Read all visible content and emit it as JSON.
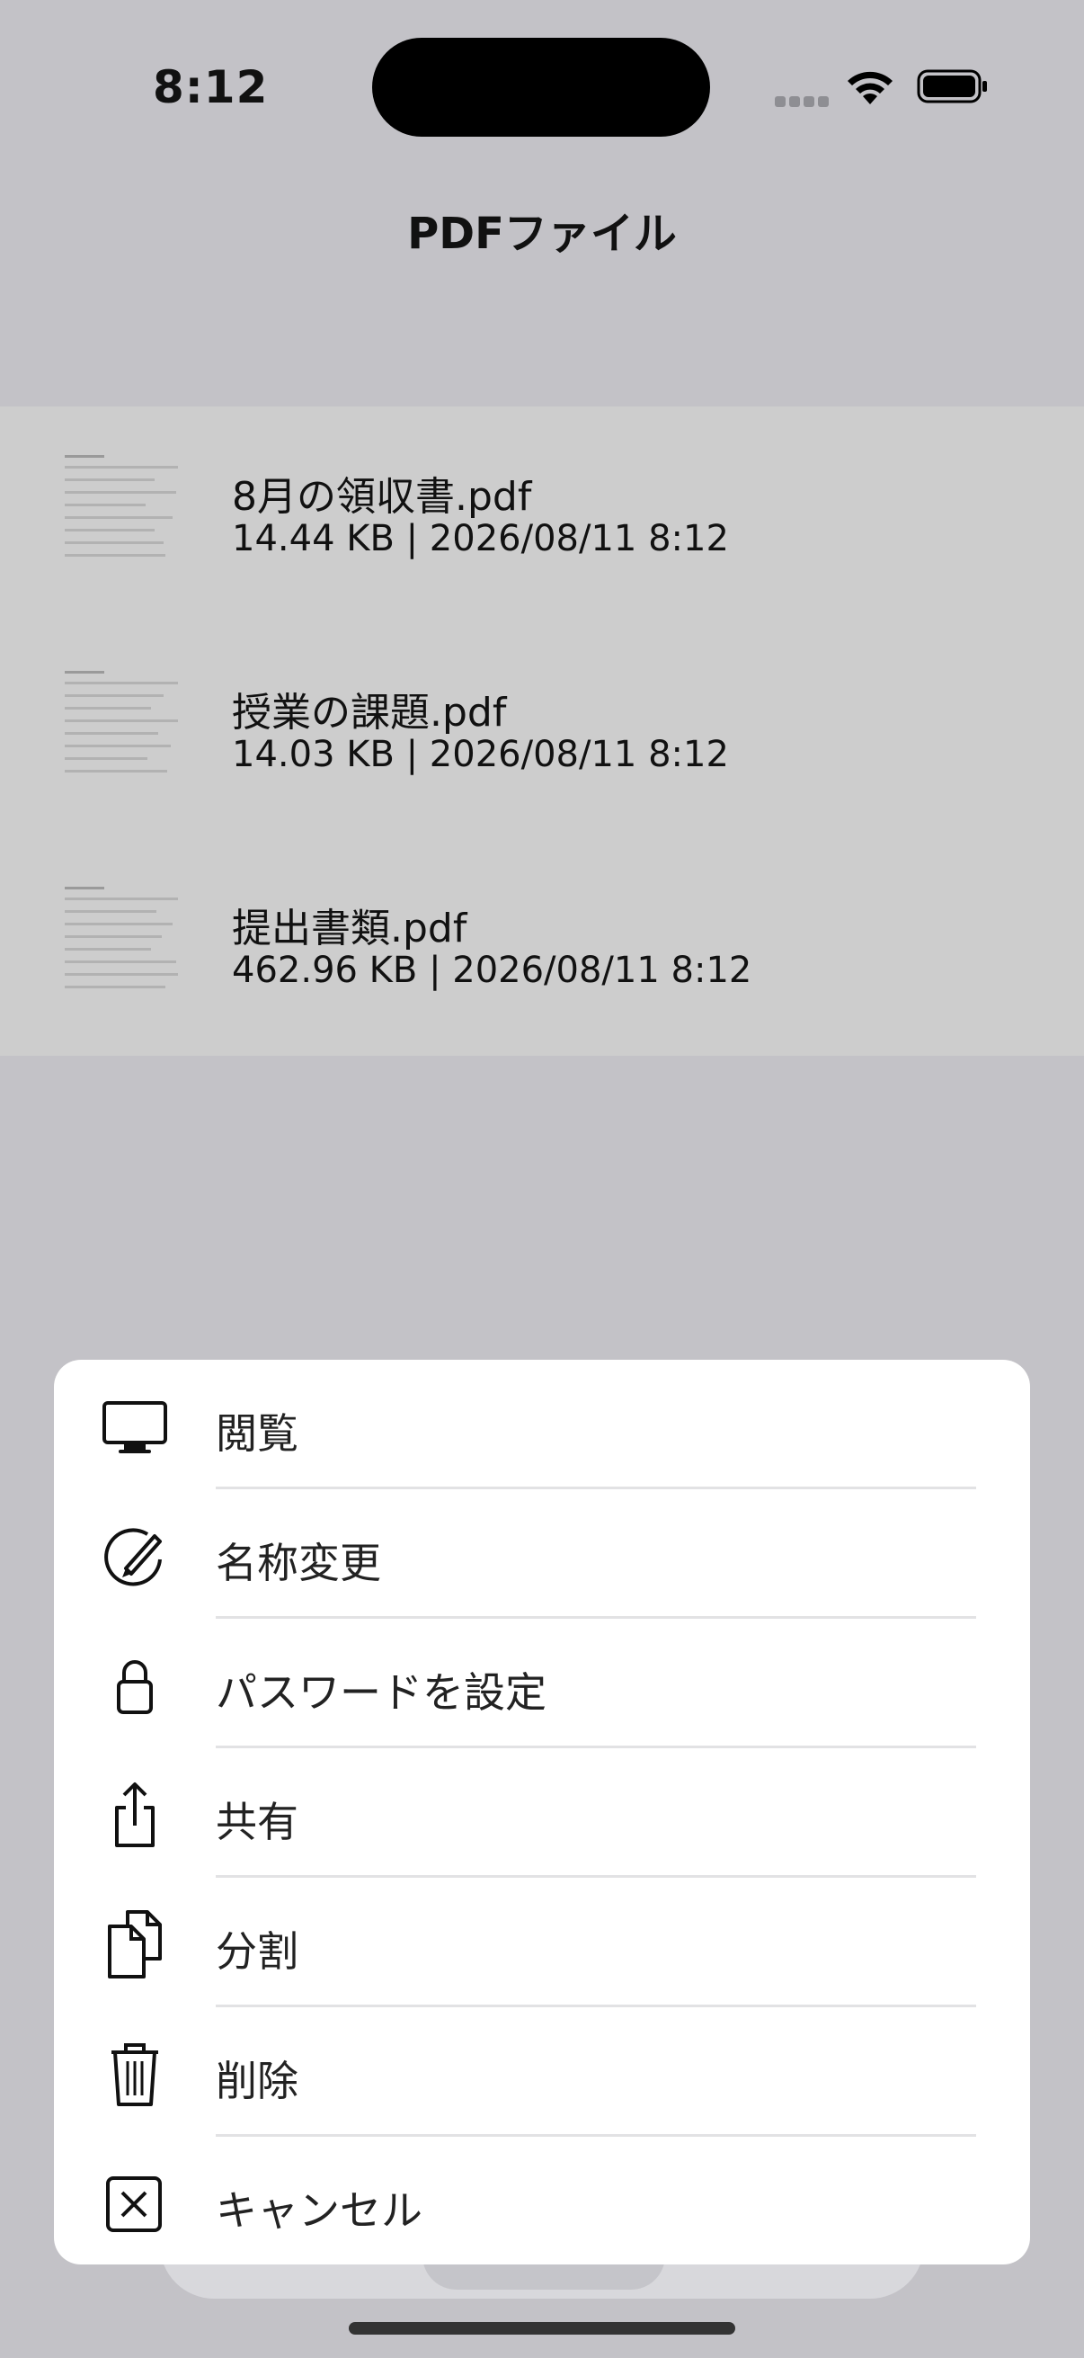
{
  "status_bar": {
    "time": "8:12"
  },
  "header": {
    "title": "PDFファイル"
  },
  "files": [
    {
      "name": "8月の領収書.pdf",
      "meta": "14.44 KB | 2026/08/11 8:12"
    },
    {
      "name": "授業の課題.pdf",
      "meta": "14.03 KB | 2026/08/11 8:12"
    },
    {
      "name": "提出書類.pdf",
      "meta": "462.96 KB | 2026/08/11 8:12"
    }
  ],
  "action_sheet": {
    "items": [
      {
        "icon": "display-icon",
        "label": "閲覧"
      },
      {
        "icon": "pencil-circle-icon",
        "label": "名称変更"
      },
      {
        "icon": "lock-icon",
        "label": "パスワードを設定"
      },
      {
        "icon": "share-icon",
        "label": "共有"
      },
      {
        "icon": "documents-icon",
        "label": "分割"
      },
      {
        "icon": "trash-icon",
        "label": "削除"
      },
      {
        "icon": "xmark-square-icon",
        "label": "キャンセル"
      }
    ]
  },
  "colors": {
    "dimmed_background": "#c3c2c7",
    "list_background": "#cdcdcd",
    "sheet_background": "#ffffff"
  }
}
